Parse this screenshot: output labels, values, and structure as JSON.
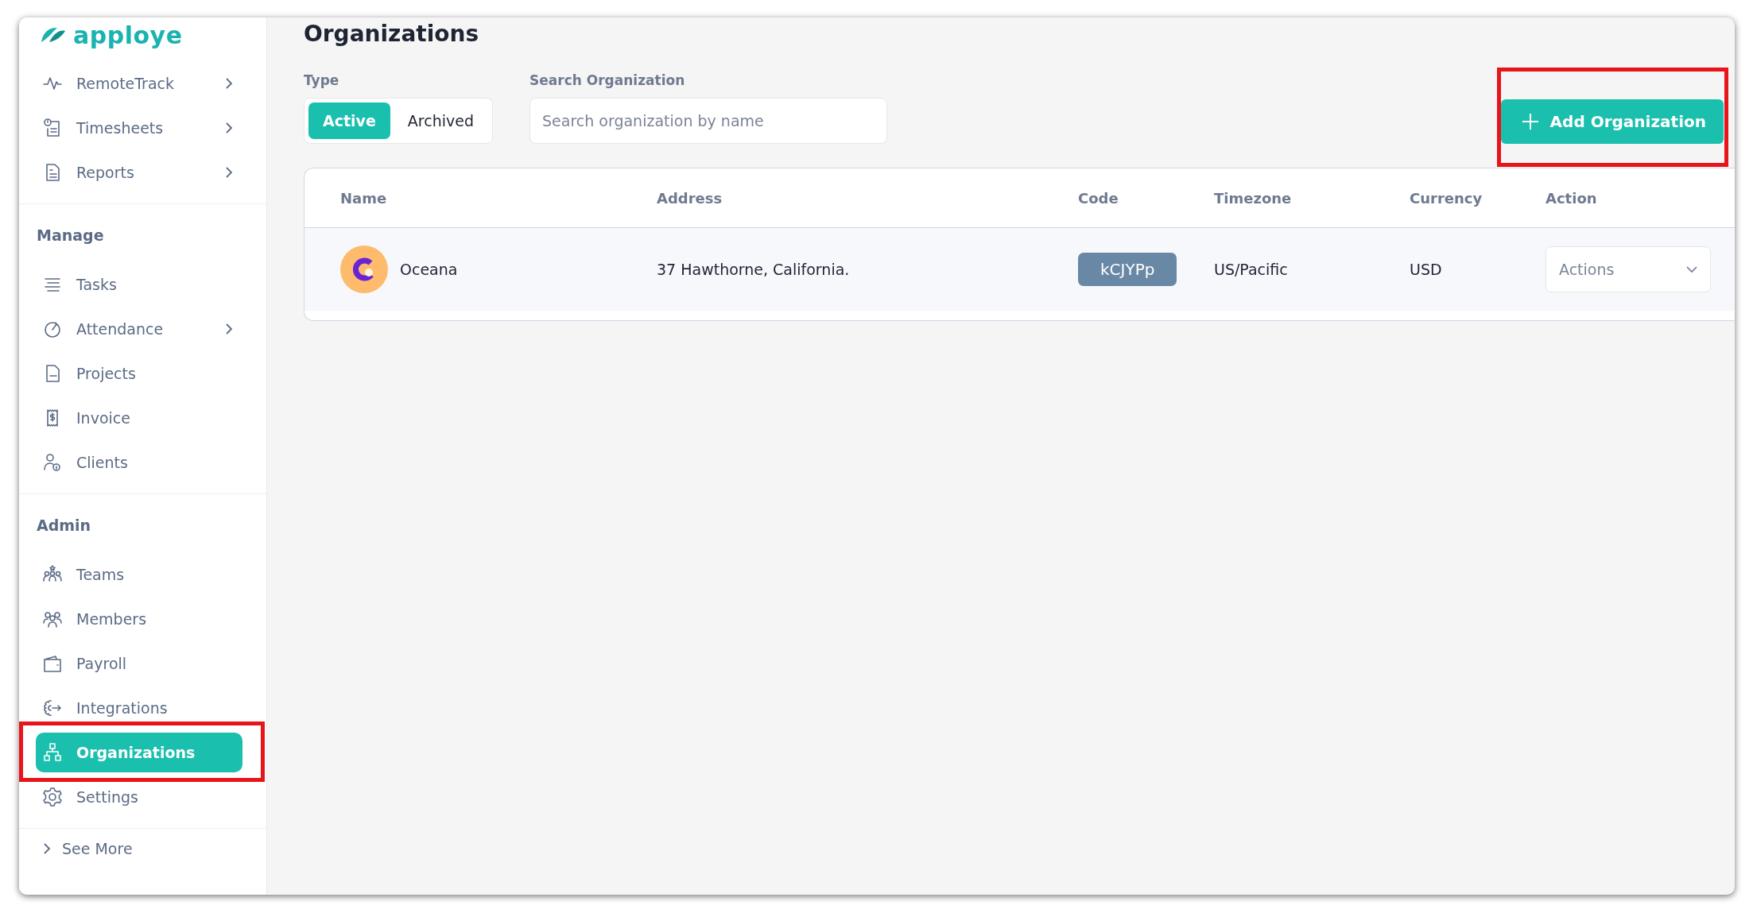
{
  "logo": {
    "text": "apploye"
  },
  "sidebar": {
    "sections": [
      {
        "items": [
          {
            "label": "RemoteTrack",
            "expandable": true,
            "selected": false
          },
          {
            "label": "Timesheets",
            "expandable": true,
            "selected": false
          },
          {
            "label": "Reports",
            "expandable": true,
            "selected": false
          }
        ]
      },
      {
        "heading": "Manage",
        "items": [
          {
            "label": "Tasks",
            "expandable": false,
            "selected": false
          },
          {
            "label": "Attendance",
            "expandable": true,
            "selected": false
          },
          {
            "label": "Projects",
            "expandable": false,
            "selected": false
          },
          {
            "label": "Invoice",
            "expandable": false,
            "selected": false
          },
          {
            "label": "Clients",
            "expandable": false,
            "selected": false
          }
        ]
      },
      {
        "heading": "Admin",
        "items": [
          {
            "label": "Teams",
            "expandable": false,
            "selected": false
          },
          {
            "label": "Members",
            "expandable": false,
            "selected": false
          },
          {
            "label": "Payroll",
            "expandable": false,
            "selected": false
          },
          {
            "label": "Integrations",
            "expandable": false,
            "selected": false
          },
          {
            "label": "Organizations",
            "expandable": false,
            "selected": true,
            "highlighted": true
          },
          {
            "label": "Settings",
            "expandable": false,
            "selected": false
          }
        ]
      }
    ],
    "see_more": "See More"
  },
  "page": {
    "title": "Organizations"
  },
  "filters": {
    "type_label": "Type",
    "type_options": [
      {
        "label": "Active",
        "selected": true
      },
      {
        "label": "Archived",
        "selected": false
      }
    ],
    "search": {
      "label": "Search Organization",
      "placeholder": "Search organization by name"
    }
  },
  "add_button": {
    "label": "Add Organization",
    "highlighted": true
  },
  "table": {
    "columns": [
      "Name",
      "Address",
      "Code",
      "Timezone",
      "Currency",
      "Action"
    ],
    "rows": [
      {
        "name": "Oceana",
        "address": "37 Hawthorne, California.",
        "code": "kCJYPp",
        "timezone": "US/Pacific",
        "currency": "USD",
        "action": "Actions"
      }
    ]
  }
}
